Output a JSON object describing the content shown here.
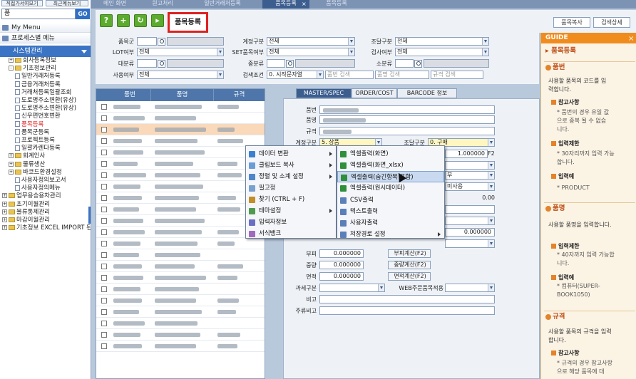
{
  "sidebar": {
    "top_buttons": [
      "직접가서여모기",
      "최근메뉴보기"
    ],
    "search_value": "품",
    "go_label": "GO",
    "my_menu": "My Menu",
    "process_menu": "프로세스별 메뉴",
    "system_menu": "시스템관리",
    "tree": [
      {
        "label": "회사등록정보",
        "level": 1,
        "type": "folder",
        "exp": "+"
      },
      {
        "label": "기초정보관리",
        "level": 1,
        "type": "folder",
        "exp": "-"
      },
      {
        "label": "일반거래처등록",
        "level": 2,
        "type": "page"
      },
      {
        "label": "금융거래처등록",
        "level": 2,
        "type": "page"
      },
      {
        "label": "거래처등록일괄조회",
        "level": 2,
        "type": "page"
      },
      {
        "label": "도로명주소변환(유상)",
        "level": 2,
        "type": "page"
      },
      {
        "label": "도로명주소변환(유상)",
        "level": 2,
        "type": "page"
      },
      {
        "label": "신우편번호변환",
        "level": 2,
        "type": "page"
      },
      {
        "label": "품목등록",
        "level": 2,
        "type": "page",
        "selected": true
      },
      {
        "label": "품목군등록",
        "level": 2,
        "type": "page"
      },
      {
        "label": "프로젝트등록",
        "level": 2,
        "type": "page"
      },
      {
        "label": "일괄카렌다등록",
        "level": 2,
        "type": "page"
      },
      {
        "label": "회계인사",
        "level": 1,
        "type": "folder",
        "exp": "+"
      },
      {
        "label": "물류생산",
        "level": 1,
        "type": "folder",
        "exp": "+"
      },
      {
        "label": "바코드환경설정",
        "level": 1,
        "type": "folder",
        "exp": "+"
      },
      {
        "label": "사용자정의보고서",
        "level": 2,
        "type": "page"
      },
      {
        "label": "사용자정의메뉴",
        "level": 2,
        "type": "page"
      },
      {
        "label": "업무용승용차관리",
        "level": 0,
        "type": "folder",
        "exp": "+"
      },
      {
        "label": "초기이월관리",
        "level": 0,
        "type": "folder",
        "exp": "+"
      },
      {
        "label": "물류통제관리",
        "level": 0,
        "type": "folder",
        "exp": "+"
      },
      {
        "label": "마감이월관리",
        "level": 0,
        "type": "folder",
        "exp": "+"
      },
      {
        "label": "기초정보 EXCEL IMPORT 된",
        "level": 0,
        "type": "folder",
        "exp": "+"
      }
    ]
  },
  "tabs": [
    "메인 화면",
    "원고처리",
    "일반거래처등록",
    "품목등록",
    "품목등록"
  ],
  "toolbar": {
    "title": "품목등록",
    "copy_btn": "품목복사",
    "detail_btn": "검색상세"
  },
  "filter": {
    "labels": {
      "group": "품목군",
      "lot": "LOT여부",
      "major": "대분류",
      "use": "사용여부",
      "acct": "계정구분",
      "set": "SET품목여부",
      "mid": "중분류",
      "cond": "검색조건",
      "proc": "조달구분",
      "insp": "검사여부",
      "minor": "소분류"
    },
    "values": {
      "lot": "전체",
      "use": "전체",
      "acct": "전체",
      "set": "전체",
      "cond": "0. 시작문자열",
      "proc": "전체",
      "insp": "전체"
    },
    "placeholders": {
      "code": "품번 검색",
      "name": "품명 검색",
      "spec": "규격 검색"
    }
  },
  "grid": {
    "headers": [
      "품번",
      "품명",
      "규격"
    ]
  },
  "detail": {
    "tabs": [
      "MASTER/SPEC",
      "ORDER/COST",
      "BARCODE 정보"
    ],
    "labels": {
      "code": "품번",
      "name": "품명",
      "spec": "규격",
      "acct": "계정구분",
      "proc": "조달구분",
      "width": "부피",
      "weight": "중량",
      "area": "면적",
      "tax": "과세구분",
      "note": "비고",
      "main_note": "주류비고",
      "web": "WEB주문품목적용"
    },
    "values": {
      "acct": "5. 상품",
      "proc": "0. 구매",
      "factor": "1.000000",
      "f2": "F2",
      "opt1": "부",
      "opt2": "미사용",
      "num": "0.00",
      "vol": "0.000000",
      "vol_r": "0.000000",
      "weight": "0.000000",
      "area": "0.000000"
    },
    "buttons": {
      "vol": "부피계산(F2)",
      "weight": "중량계산(F2)",
      "area": "면적계산(F2)"
    }
  },
  "context_menu": {
    "items": [
      "데이터 변환",
      "클립보드 복사",
      "정렬 및 소계 설정",
      "필고정",
      "찾기 (CTRL + F)",
      "테마설정",
      "입력자정보",
      "서식뱅크"
    ],
    "submenu": [
      "엑셀출력(화면)",
      "엑셀출력(화면_xlsx)",
      "엑셀출력(숨긴항목 포함)",
      "엑셀출력(원시데이터)",
      "CSV출력",
      "텍스트출력",
      "사용자출력",
      "저장경로 설정"
    ]
  },
  "guide": {
    "header": "GUIDE",
    "title": "품목등록",
    "s1": "품번",
    "s1_desc": [
      "사용할 품목의 코드를 입",
      "력합니다."
    ],
    "s1_ref": "참고사항",
    "s1_ref_desc": [
      "* 품번의 경우 유일 값",
      "으로 중복 될 수 없습",
      "니다."
    ],
    "s1_in": "입력제한",
    "s1_in_desc": [
      "* 30자리까지 입력 가능",
      "합니다."
    ],
    "s1_ex": "입력예",
    "s1_ex_desc": [
      "* PRODUCT"
    ],
    "s2": "품명",
    "s2_desc": [
      "사용할 품명을 입력합니다."
    ],
    "s2_in": "입력제한",
    "s2_in_desc": [
      "* 40자까지 입력 가능합",
      "니다."
    ],
    "s2_ex": "입력예",
    "s2_ex_desc": [
      "* 컴퓨터(SUPER-",
      "BOOK1050)"
    ],
    "s3": "규격",
    "s3_desc": [
      "사용할 품목의 규격을 입력",
      "합니다."
    ],
    "s3_ref": "참고사항",
    "s3_ref_desc": [
      "* 규격의 경우 참고사항",
      "으로 해당 품목에 대"
    ]
  }
}
